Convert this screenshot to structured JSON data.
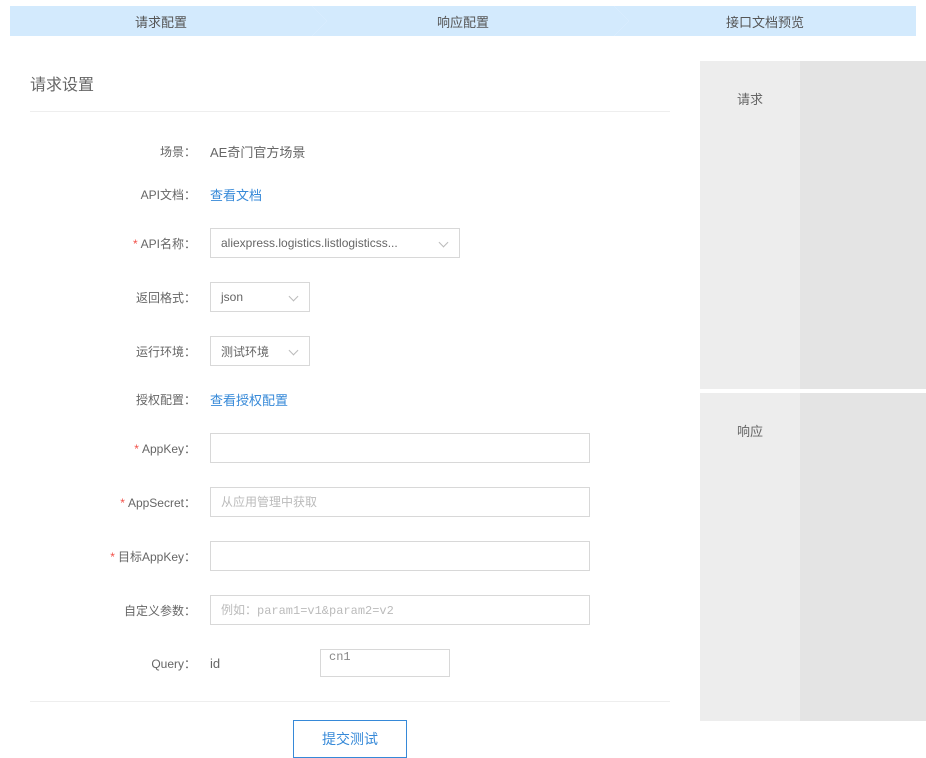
{
  "stepper": {
    "steps": [
      "请求配置",
      "响应配置",
      "接口文档预览"
    ]
  },
  "section_title": "请求设置",
  "form": {
    "scene": {
      "label": "场景：",
      "value": "AE奇门官方场景"
    },
    "api_doc": {
      "label": "API文档：",
      "link": "查看文档"
    },
    "api_name": {
      "label": "API名称：",
      "value": "aliexpress.logistics.listlogisticss..."
    },
    "ret_format": {
      "label": "返回格式：",
      "value": "json"
    },
    "env": {
      "label": "运行环境：",
      "value": "测试环境"
    },
    "auth_cfg": {
      "label": "授权配置：",
      "link": "查看授权配置"
    },
    "app_key": {
      "label": "AppKey：",
      "value": ""
    },
    "app_secret": {
      "label": "AppSecret：",
      "placeholder": "从应用管理中获取",
      "value": ""
    },
    "target_key": {
      "label": "目标AppKey：",
      "value": ""
    },
    "custom_param": {
      "label": "自定义参数：",
      "placeholder": "例如：param1=v1&param2=v2",
      "value": ""
    },
    "query": {
      "label": "Query：",
      "key": "id",
      "value": "cn1"
    }
  },
  "submit_label": "提交测试",
  "right": {
    "request_label": "请求",
    "response_label": "响应"
  }
}
